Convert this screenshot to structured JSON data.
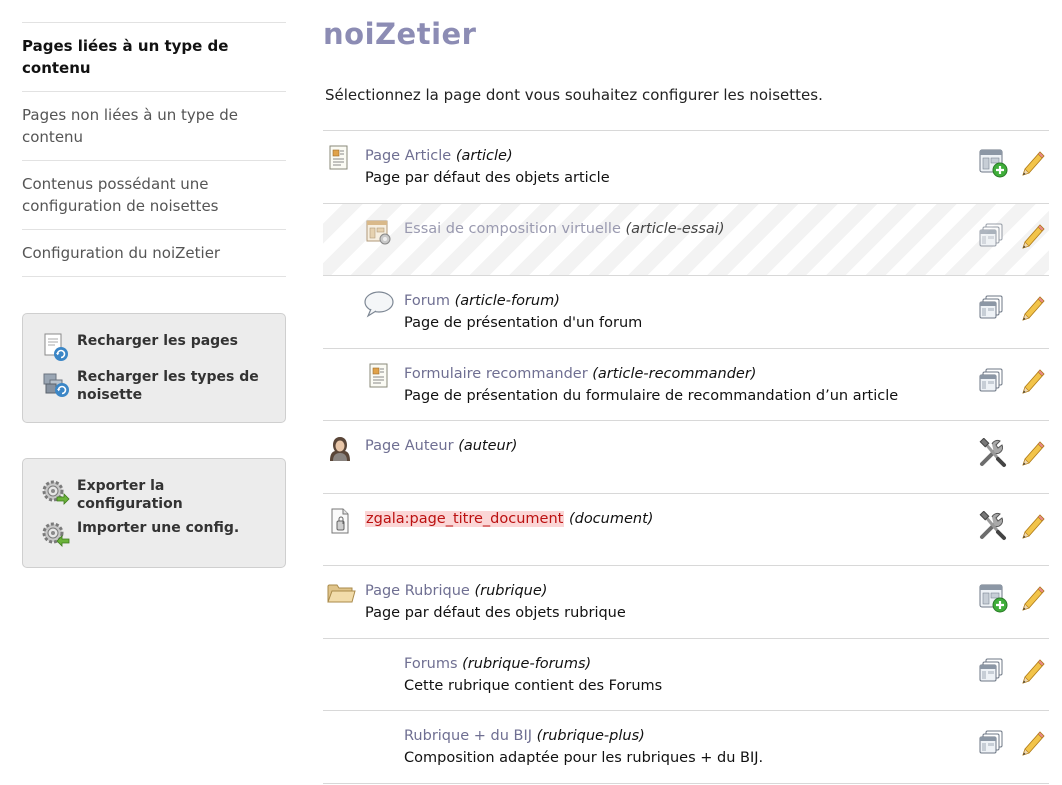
{
  "sidebar": {
    "nav": [
      {
        "label": "Pages liées à un type de contenu",
        "active": true
      },
      {
        "label": "Pages non liées à un type de contenu",
        "active": false
      },
      {
        "label": "Contenus possédant une configuration de noisettes",
        "active": false
      },
      {
        "label": "Configuration du noiZetier",
        "active": false
      }
    ],
    "reload_box": {
      "reload_pages": "Recharger les pages",
      "reload_types": "Recharger les types de noisette"
    },
    "config_box": {
      "export": "Exporter la configuration",
      "import": "Importer une config."
    }
  },
  "main": {
    "title": "noiZetier",
    "intro": "Sélectionnez la page dont vous souhaitez configurer les noisettes.",
    "pages": [
      {
        "title": "Page Article",
        "id": "(article)",
        "desc": "Page par défaut des objets article",
        "icon": "article-page-icon",
        "action_icon": "add-composition-icon"
      },
      {
        "title": "Essai de composition virtuelle",
        "id": "(article-essai)",
        "desc": "",
        "icon": "composition-icon",
        "action_icon": "compositions-icon"
      },
      {
        "title": "Forum",
        "id": "(article-forum)",
        "desc": "Page de présentation d'un forum",
        "icon": "speech-bubble-icon",
        "action_icon": "compositions-icon"
      },
      {
        "title": "Formulaire recommander",
        "id": "(article-recommander)",
        "desc": "Page de présentation du formulaire de recommandation d’un article",
        "icon": "form-page-icon",
        "action_icon": "compositions-icon"
      },
      {
        "title": "Page Auteur",
        "id": "(auteur)",
        "desc": "",
        "icon": "author-icon",
        "action_icon": "tools-icon"
      },
      {
        "title": "zgala:page_titre_document",
        "id": "(document)",
        "desc": "",
        "icon": "document-icon",
        "action_icon": "tools-icon"
      },
      {
        "title": "Page Rubrique",
        "id": "(rubrique)",
        "desc": "Page par défaut des objets rubrique",
        "icon": "folder-icon",
        "action_icon": "add-composition-icon"
      },
      {
        "title": "Forums",
        "id": "(rubrique-forums)",
        "desc": "Cette rubrique contient des Forums",
        "icon": "",
        "action_icon": "compositions-icon"
      },
      {
        "title": "Rubrique + du BIJ",
        "id": "(rubrique-plus)",
        "desc": "Composition adaptée pour les rubriques + du BIJ.",
        "icon": "",
        "action_icon": "compositions-icon"
      }
    ]
  },
  "colors": {
    "title": "#8c8cb4",
    "link": "#6f6f92",
    "missing_translation_bg": "#fbd6d6",
    "missing_translation_text": "#b11111"
  }
}
